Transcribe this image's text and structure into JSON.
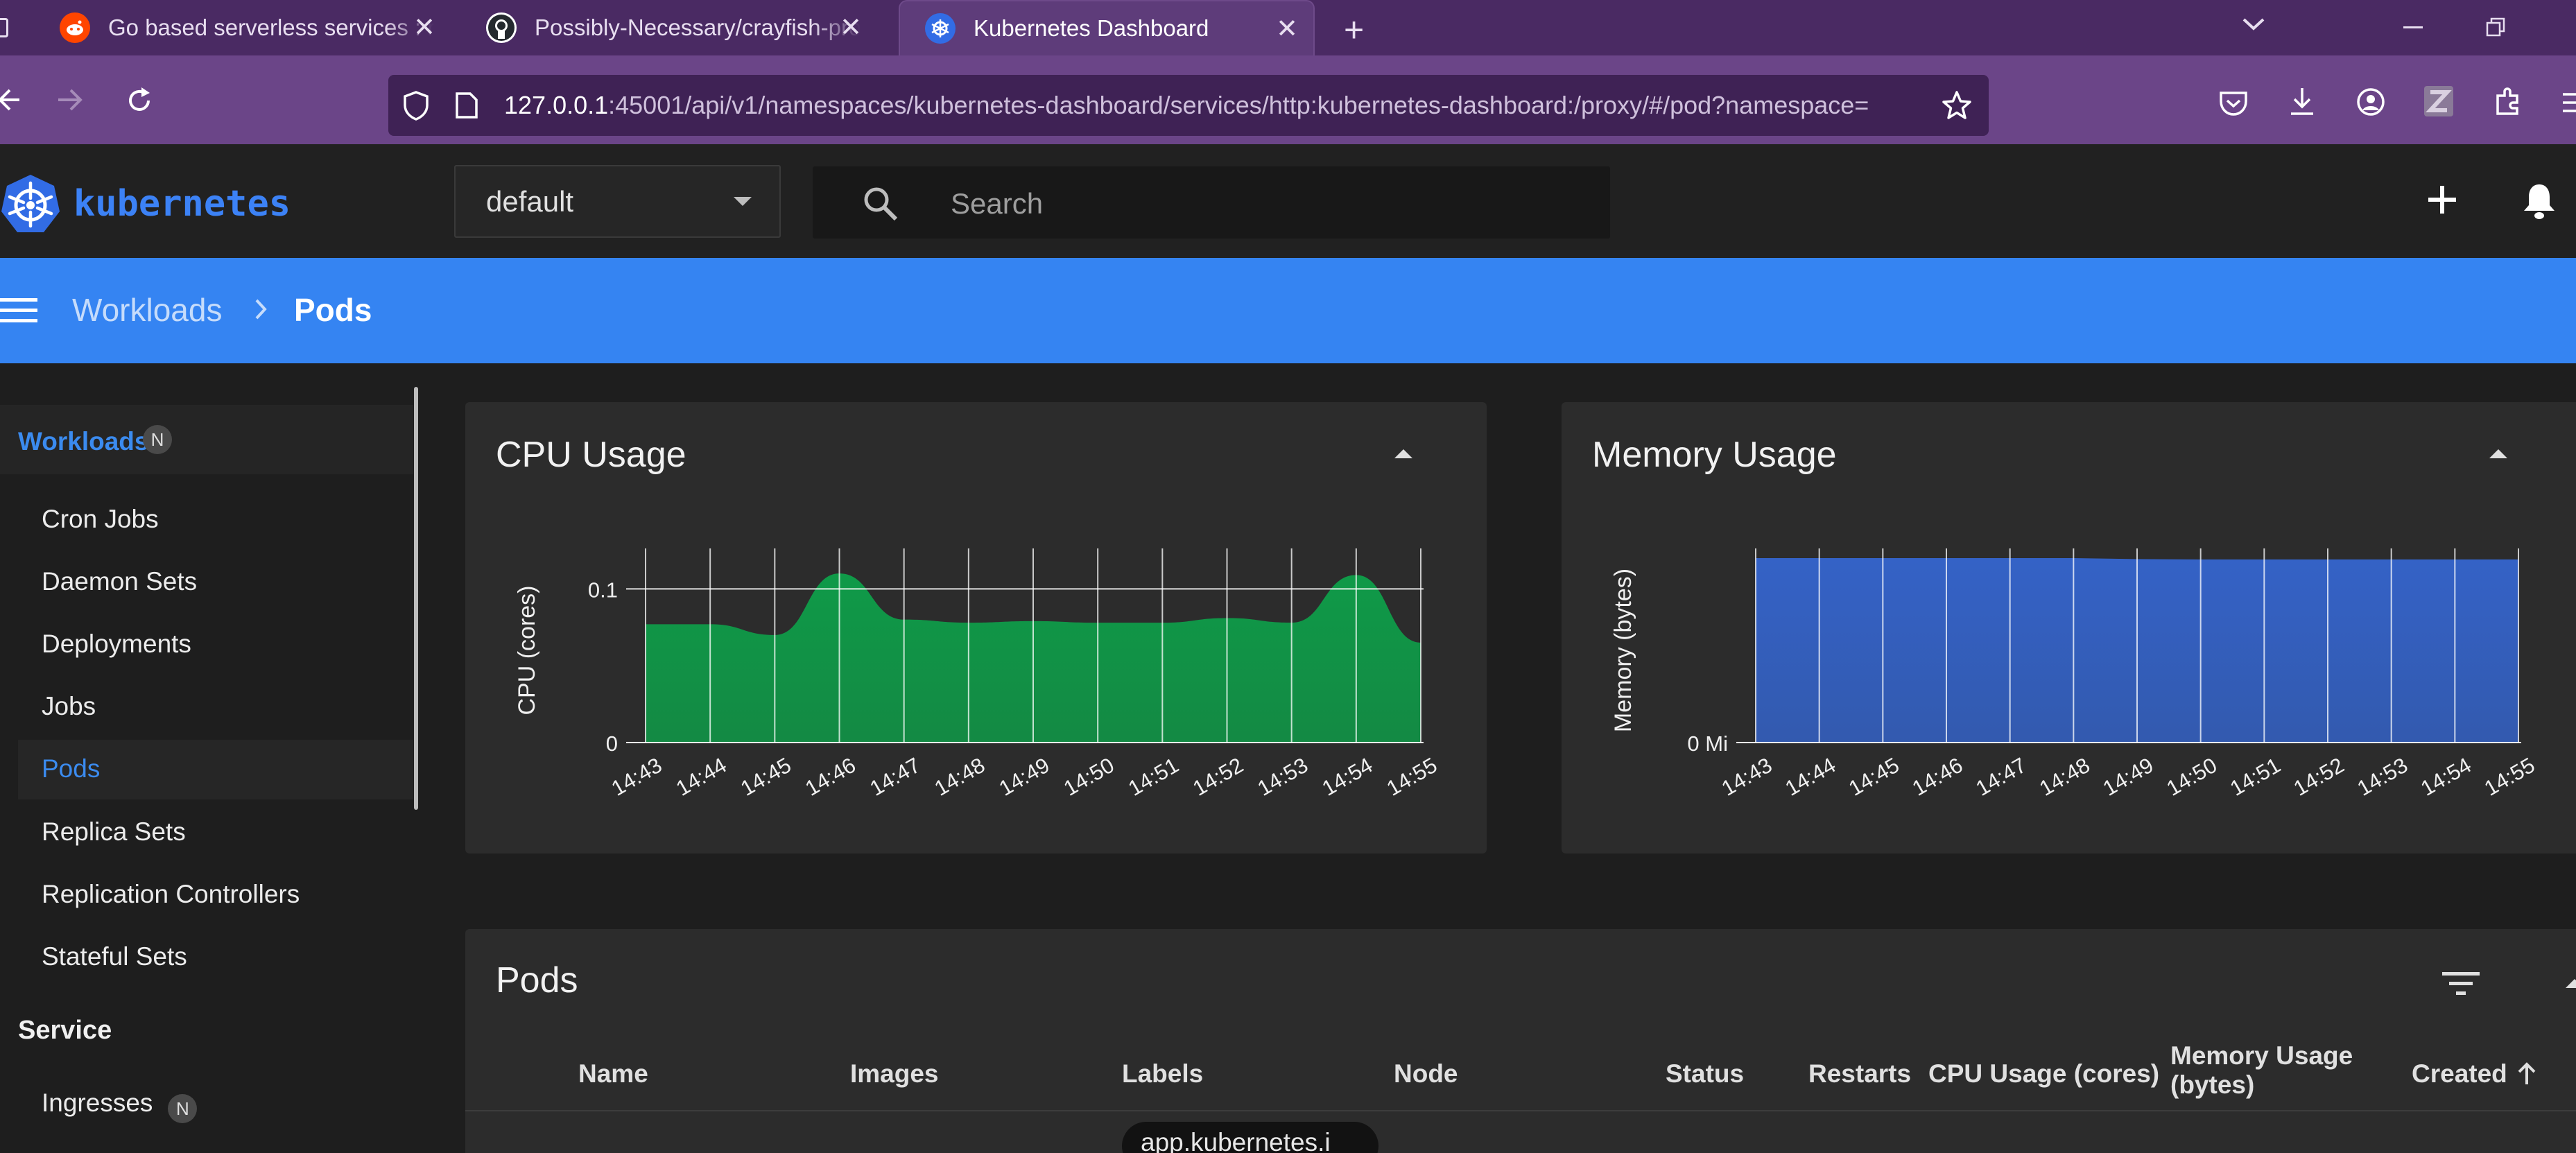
{
  "browser": {
    "tabs": [
      {
        "title": "Go based serverless services : r/",
        "favicon": "reddit-icon",
        "active": false
      },
      {
        "title": "Possibly-Necessary/crayfish-pro",
        "favicon": "github-icon",
        "active": false
      },
      {
        "title": "Kubernetes Dashboard",
        "favicon": "kubernetes-icon",
        "active": true
      }
    ],
    "url_host": "127.0.0.1",
    "url_rest": ":45001/api/v1/namespaces/kubernetes-dashboard/services/http:kubernetes-dashboard:/proxy/#/pod?namespace="
  },
  "app": {
    "logo_text": "kubernetes",
    "namespace": "default",
    "search_placeholder": "Search"
  },
  "breadcrumb": {
    "parent": "Workloads",
    "current": "Pods"
  },
  "sidebar": {
    "section_workloads": "Workloads",
    "badge": "N",
    "items": [
      "Cron Jobs",
      "Daemon Sets",
      "Deployments",
      "Jobs",
      "Pods",
      "Replica Sets",
      "Replication Controllers",
      "Stateful Sets"
    ],
    "active_item": "Pods",
    "section_service": "Service",
    "service_items": [
      "Ingresses"
    ]
  },
  "cpu_card": {
    "title": "CPU Usage"
  },
  "memory_card": {
    "title": "Memory Usage"
  },
  "pods_card": {
    "title": "Pods",
    "columns": [
      "Name",
      "Images",
      "Labels",
      "Node",
      "Status",
      "Restarts",
      "CPU Usage (cores)",
      "Memory Usage (bytes)",
      "Created"
    ],
    "memory_col_line1": "Memory Usage",
    "memory_col_line2": "(bytes)",
    "first_row_label_chip": "app.kubernetes.i"
  },
  "colors": {
    "accent_blue": "#3584f2",
    "cpu_fill": "#0f9a48",
    "memory_fill": "#3462c6",
    "tabstrip": "#4a2a63",
    "toolbar": "#6b4588"
  },
  "chart_data": [
    {
      "type": "area",
      "title": "CPU Usage",
      "ylabel": "CPU (cores)",
      "x": [
        "14:43",
        "14:44",
        "14:45",
        "14:46",
        "14:47",
        "14:48",
        "14:49",
        "14:50",
        "14:51",
        "14:52",
        "14:53",
        "14:54",
        "14:55"
      ],
      "values": [
        0.077,
        0.077,
        0.07,
        0.11,
        0.08,
        0.078,
        0.079,
        0.078,
        0.078,
        0.081,
        0.078,
        0.109,
        0.065
      ],
      "yticks": [
        {
          "v": 0,
          "label": "0"
        },
        {
          "v": 0.1,
          "label": "0.1"
        }
      ],
      "ylim": [
        0,
        0.12
      ],
      "grid": true,
      "color": "#0f9a48"
    },
    {
      "type": "area",
      "title": "Memory Usage",
      "ylabel": "Memory (bytes)",
      "x": [
        "14:43",
        "14:44",
        "14:45",
        "14:46",
        "14:47",
        "14:48",
        "14:49",
        "14:50",
        "14:51",
        "14:52",
        "14:53",
        "14:54",
        "14:55"
      ],
      "values": [
        1,
        1,
        1,
        1,
        1,
        1,
        0.995,
        0.993,
        0.993,
        0.993,
        0.993,
        0.993,
        0.993
      ],
      "yticks": [
        {
          "v": 0,
          "label": "0 Mi"
        }
      ],
      "ylim": [
        0,
        1
      ],
      "grid": true,
      "color": "#3462c6"
    }
  ]
}
